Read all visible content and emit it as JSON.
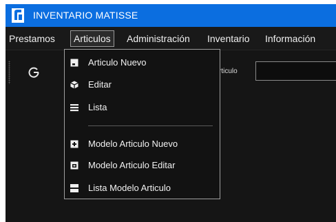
{
  "window": {
    "title": "INVENTARIO MATISSE",
    "accent_color": "#0b6ee0",
    "logo_icon": "app-logo-icon"
  },
  "menubar": {
    "items": [
      {
        "label": "Prestamos"
      },
      {
        "label": "Articulos",
        "active": true
      },
      {
        "label": "Administración"
      },
      {
        "label": "Inventario"
      },
      {
        "label": "Información"
      }
    ]
  },
  "toolbar": {
    "refresh_icon": "refresh-icon",
    "globe_icon": "globe-icon",
    "search_label": "rticulo",
    "search_value": ""
  },
  "articulos_menu": {
    "items": [
      {
        "label": "Articulo Nuevo",
        "icon": "new-item-icon"
      },
      {
        "label": "Editar",
        "icon": "cube-icon"
      },
      {
        "label": "Lista",
        "icon": "list-icon"
      },
      {
        "label": "Modelo Articulo Nuevo",
        "icon": "add-box-icon"
      },
      {
        "label": "Modelo Articulo Editar",
        "icon": "edit-box-icon"
      },
      {
        "label": "Lista Modelo Articulo",
        "icon": "list-box-icon"
      }
    ]
  }
}
